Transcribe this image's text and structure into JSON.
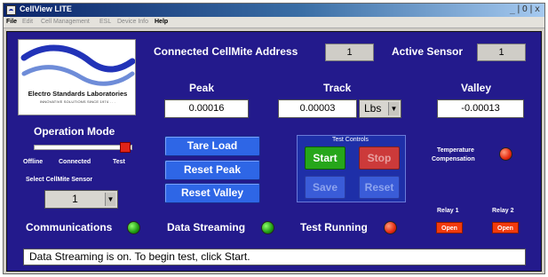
{
  "window": {
    "title": "CellView LITE",
    "controls": "_|O|x"
  },
  "menu": [
    {
      "label": "File",
      "active": true
    },
    {
      "label": "Edit",
      "active": false
    },
    {
      "label": "Cell Management",
      "active": false
    },
    {
      "label": "ESL",
      "active": false
    },
    {
      "label": "Device Info",
      "active": false
    },
    {
      "label": "Help",
      "active": true
    }
  ],
  "logo": {
    "name": "Electro Standards Laboratories",
    "tagline": "INNOVATIVE SOLUTIONS SINCE 1974 . . ."
  },
  "header": {
    "address_label": "Connected CellMite Address",
    "address_value": "1",
    "sensor_label": "Active Sensor",
    "sensor_value": "1"
  },
  "readings": {
    "peak_label": "Peak",
    "peak_value": "0.00016",
    "track_label": "Track",
    "track_value": "0.00003",
    "units_value": "Lbs",
    "valley_label": "Valley",
    "valley_value": "-0.00013"
  },
  "operation_mode": {
    "title": "Operation Mode",
    "options": [
      "Offline",
      "Connected",
      "Test"
    ],
    "selected": "Test"
  },
  "sensor_select": {
    "label": "Select CellMite Sensor",
    "value": "1"
  },
  "buttons": {
    "tare": "Tare Load",
    "reset_peak": "Reset Peak",
    "reset_valley": "Reset Valley"
  },
  "test_controls": {
    "title": "Test Controls",
    "start": "Start",
    "stop": "Stop",
    "save": "Save",
    "reset": "Reset"
  },
  "temperature": {
    "label_line1": "Temperature",
    "label_line2": "Compensation"
  },
  "indicators": {
    "communications": "Communications",
    "data_streaming": "Data Streaming",
    "test_running": "Test Running"
  },
  "relays": {
    "relay1_label": "Relay 1",
    "relay1_button": "Open",
    "relay2_label": "Relay 2",
    "relay2_button": "Open"
  },
  "status": "Data Streaming is on. To begin test, click Start.",
  "colors": {
    "panel_bg": "#231a8c",
    "button_blue": "#2e66e6",
    "start_green": "#26a61a",
    "stop_red": "#cc3a3a",
    "led_green": "#1f9a12",
    "led_red": "#e52a10",
    "relay_orange": "#f23a0c"
  }
}
